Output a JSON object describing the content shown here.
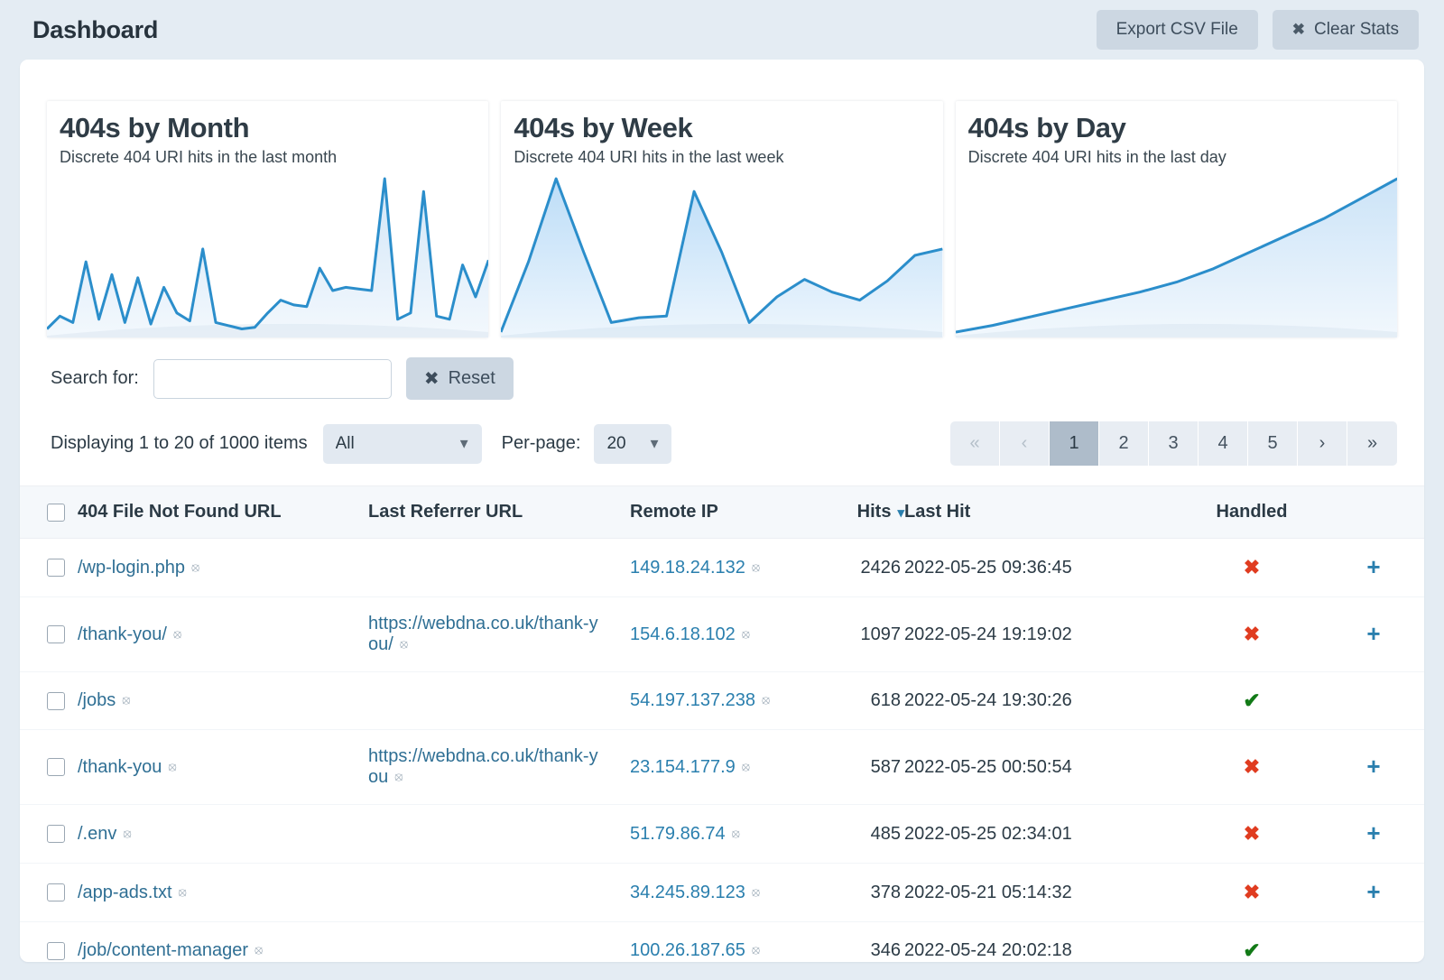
{
  "header": {
    "title": "Dashboard",
    "export_label": "Export CSV File",
    "clear_label": "Clear Stats",
    "clear_icon": "x-icon"
  },
  "charts": [
    {
      "title": "404s by Month",
      "subtitle": "Discrete 404 URI hits in the last month"
    },
    {
      "title": "404s by Week",
      "subtitle": "Discrete 404 URI hits in the last week"
    },
    {
      "title": "404s by Day",
      "subtitle": "Discrete 404 URI hits in the last day"
    }
  ],
  "chart_data": [
    {
      "type": "area",
      "title": "404s by Month",
      "subtitle": "Discrete 404 URI hits in the last month",
      "xlabel": "",
      "ylabel": "",
      "grid": false,
      "legend": false,
      "line_color": "#2b8ecb",
      "fill_color": "#cfe4f7",
      "values": [
        2,
        10,
        6,
        44,
        8,
        36,
        6,
        34,
        5,
        28,
        12,
        7,
        52,
        6,
        4,
        2,
        3,
        12,
        20,
        17,
        16,
        40,
        26,
        28,
        27,
        26,
        96,
        8,
        12,
        88,
        10,
        8,
        42,
        22,
        45
      ]
    },
    {
      "type": "area",
      "title": "404s by Week",
      "subtitle": "Discrete 404 URI hits in the last week",
      "xlabel": "",
      "ylabel": "",
      "grid": false,
      "legend": false,
      "line_color": "#2b8ecb",
      "fill_color": "#b9dbf7",
      "values": [
        0,
        44,
        96,
        50,
        6,
        9,
        10,
        88,
        50,
        6,
        22,
        33,
        25,
        20,
        32,
        48,
        52
      ]
    },
    {
      "type": "area",
      "title": "404s by Day",
      "subtitle": "Discrete 404 URI hits in the last day",
      "xlabel": "",
      "ylabel": "",
      "grid": false,
      "legend": false,
      "line_color": "#2b8ecb",
      "fill_color": "#c9e2f7",
      "values": [
        0,
        4,
        9,
        14,
        19,
        24,
        30,
        38,
        48,
        58,
        68,
        80,
        92
      ]
    }
  ],
  "search": {
    "label": "Search for:",
    "value": "",
    "placeholder": "",
    "reset_label": "Reset",
    "reset_icon": "x-icon"
  },
  "controls": {
    "displaying": "Displaying 1 to 20 of 1000 items",
    "filter_value": "All",
    "filter_options": [
      "All"
    ],
    "perpage_label": "Per-page:",
    "perpage_value": "20",
    "perpage_options": [
      "20"
    ]
  },
  "pagination": {
    "first": "«",
    "prev": "‹",
    "pages": [
      "1",
      "2",
      "3",
      "4",
      "5"
    ],
    "active": "1",
    "next": "›",
    "last": "»"
  },
  "table": {
    "columns": {
      "url": "404 File Not Found URL",
      "referrer": "Last Referrer URL",
      "ip": "Remote IP",
      "hits": "Hits",
      "hits_sort": "chevron-down-icon",
      "last_hit": "Last Hit",
      "handled": "Handled"
    },
    "rows": [
      {
        "url": "/wp-login.php",
        "referrer": "",
        "ip": "149.18.24.132",
        "hits": "2426",
        "last_hit": "2022-05-25 09:36:45",
        "handled": "✖",
        "handled_state": "no",
        "action": "+"
      },
      {
        "url": "/thank-you/",
        "referrer": "https://webdna.co.uk/thank-you/",
        "ip": "154.6.18.102",
        "hits": "1097",
        "last_hit": "2022-05-24 19:19:02",
        "handled": "✖",
        "handled_state": "no",
        "action": "+"
      },
      {
        "url": "/jobs",
        "referrer": "",
        "ip": "54.197.137.238",
        "hits": "618",
        "last_hit": "2022-05-24 19:30:26",
        "handled": "✔",
        "handled_state": "yes",
        "action": ""
      },
      {
        "url": "/thank-you",
        "referrer": "https://webdna.co.uk/thank-you",
        "ip": "23.154.177.9",
        "hits": "587",
        "last_hit": "2022-05-25 00:50:54",
        "handled": "✖",
        "handled_state": "no",
        "action": "+"
      },
      {
        "url": "/.env",
        "referrer": "",
        "ip": "51.79.86.74",
        "hits": "485",
        "last_hit": "2022-05-25 02:34:01",
        "handled": "✖",
        "handled_state": "no",
        "action": "+"
      },
      {
        "url": "/app-ads.txt",
        "referrer": "",
        "ip": "34.245.89.123",
        "hits": "378",
        "last_hit": "2022-05-21 05:14:32",
        "handled": "✖",
        "handled_state": "no",
        "action": "+"
      },
      {
        "url": "/job/content-manager",
        "referrer": "",
        "ip": "100.26.187.65",
        "hits": "346",
        "last_hit": "2022-05-24 20:02:18",
        "handled": "✔",
        "handled_state": "yes",
        "action": ""
      }
    ]
  },
  "colors": {
    "page_bg": "#e4ecf3",
    "accent_link": "#2a7fae",
    "chart_line": "#2b8ecb",
    "danger": "#e03c20",
    "success": "#127a17"
  }
}
